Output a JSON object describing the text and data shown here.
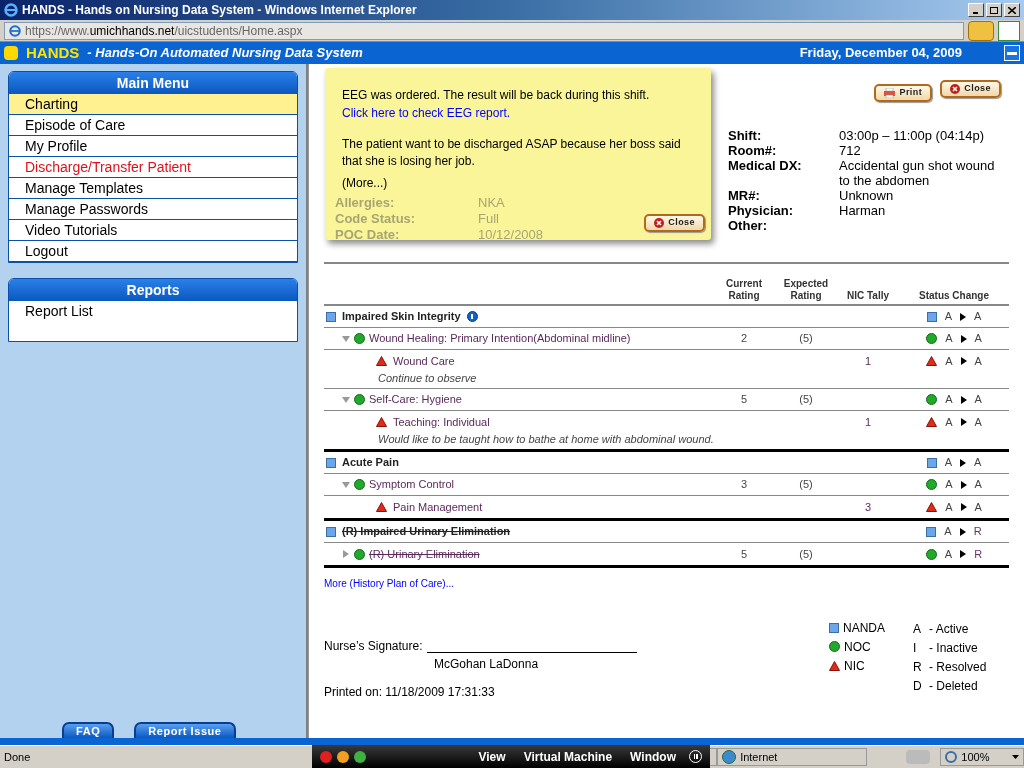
{
  "browser": {
    "title": "HANDS - Hands on Nursing Data System - Windows Internet Explorer",
    "url_prefix": "https://www.",
    "url_host": "umichhands.net",
    "url_path": "/uicstudents/Home.aspx"
  },
  "header": {
    "logo": "HANDS",
    "tagline": "- Hands-On Automated Nursing Data System",
    "date": "Friday, December 04, 2009"
  },
  "main_menu": {
    "title": "Main Menu",
    "items": [
      {
        "label": "Charting",
        "selected": true,
        "kind": "normal"
      },
      {
        "label": "Episode of Care",
        "selected": false,
        "kind": "normal"
      },
      {
        "label": "My Profile",
        "selected": false,
        "kind": "normal"
      },
      {
        "label": "Discharge/Transfer Patient",
        "selected": false,
        "kind": "warning"
      },
      {
        "label": "Manage Templates",
        "selected": false,
        "kind": "normal"
      },
      {
        "label": "Manage Passwords",
        "selected": false,
        "kind": "normal"
      },
      {
        "label": "Video Tutorials",
        "selected": false,
        "kind": "normal"
      },
      {
        "label": "Logout",
        "selected": false,
        "kind": "normal"
      }
    ]
  },
  "reports": {
    "title": "Reports",
    "items": [
      "Report List"
    ]
  },
  "sidebar_buttons": [
    "FAQ",
    "Report Issue"
  ],
  "popup": {
    "message": "EEG was ordered. The result will be back during this shift.",
    "link": "Click here to check EEG report.",
    "note": "The patient want to be discharged ASAP because her boss said that she is losing her job.",
    "more": "(More...)",
    "close": "Close"
  },
  "patient_hidden": [
    {
      "label": "Allergies:",
      "value": "NKA"
    },
    {
      "label": "Code Status:",
      "value": "Full"
    },
    {
      "label": "POC Date:",
      "value": "10/12/2008"
    }
  ],
  "actions": [
    "Print",
    "Close"
  ],
  "patient_info": [
    {
      "label": "Shift:",
      "value": "03:00p – 11:00p (04:14p)"
    },
    {
      "label": "Room#:",
      "value": "712"
    },
    {
      "label": "Medical DX:",
      "value": "Accidental gun shot wound to the abdomen"
    },
    {
      "label": "MR#:",
      "value": "Unknown"
    },
    {
      "label": "Physician:",
      "value": "Harman"
    },
    {
      "label": "Other:"
    }
  ],
  "table": {
    "columns": [
      "Current Rating",
      "Expected Rating",
      "NIC Tally",
      "Status Change"
    ],
    "diagnoses": [
      {
        "label": "Impaired Skin Integrity",
        "info": true,
        "resolved": false,
        "status_from": "A",
        "status_to": "A",
        "outcomes": [
          {
            "label": "Wound Healing: Primary Intention(Abdominal midline)",
            "expanded": true,
            "resolved": false,
            "current": "2",
            "expected": "(5)",
            "status_from": "A",
            "status_to": "A",
            "interventions": [
              {
                "label": "Wound Care",
                "tally": "1",
                "note": "Continue to observe",
                "status_from": "A",
                "status_to": "A"
              }
            ]
          },
          {
            "label": "Self-Care: Hygiene",
            "expanded": true,
            "resolved": false,
            "current": "5",
            "expected": "(5)",
            "status_from": "A",
            "status_to": "A",
            "interventions": [
              {
                "label": "Teaching: Individual",
                "tally": "1",
                "note": "Would like to be taught how to bathe at home with abdominal wound.",
                "status_from": "A",
                "status_to": "A"
              }
            ]
          }
        ]
      },
      {
        "label": "Acute Pain",
        "info": false,
        "resolved": false,
        "status_from": "A",
        "status_to": "A",
        "outcomes": [
          {
            "label": "Symptom Control",
            "expanded": true,
            "resolved": false,
            "current": "3",
            "expected": "(5)",
            "status_from": "A",
            "status_to": "A",
            "interventions": [
              {
                "label": "Pain Management",
                "tally": "3",
                "status_from": "A",
                "status_to": "A"
              }
            ]
          }
        ]
      },
      {
        "label": "(R) Impaired Urinary Elimination",
        "info": false,
        "resolved": true,
        "status_from": "A",
        "status_to": "R",
        "outcomes": [
          {
            "label": "(R) Urinary Elimination",
            "expanded": false,
            "resolved": true,
            "current": "5",
            "expected": "(5)",
            "status_from": "A",
            "status_to": "R"
          }
        ]
      }
    ]
  },
  "more_link": "More (History Plan of Care)...",
  "signature": {
    "label": "Nurse’s Signature:",
    "name": "McGohan LaDonna",
    "printed": "Printed on: 11/18/2009 17:31:33"
  },
  "legend": {
    "types": [
      {
        "kind": "nanda",
        "label": "NANDA"
      },
      {
        "kind": "noc",
        "label": "NOC"
      },
      {
        "kind": "nic",
        "label": "NIC"
      }
    ],
    "statuses": [
      {
        "code": "A",
        "label": "- Active"
      },
      {
        "code": "I",
        "label": "- Inactive"
      },
      {
        "code": "R",
        "label": "- Resolved"
      },
      {
        "code": "D",
        "label": "- Deleted"
      }
    ]
  },
  "status_bar": {
    "text": "Done",
    "zone": "Internet",
    "zoom": "100%"
  },
  "vm_bar": {
    "menus": [
      "View",
      "Virtual Machine",
      "Window"
    ]
  }
}
